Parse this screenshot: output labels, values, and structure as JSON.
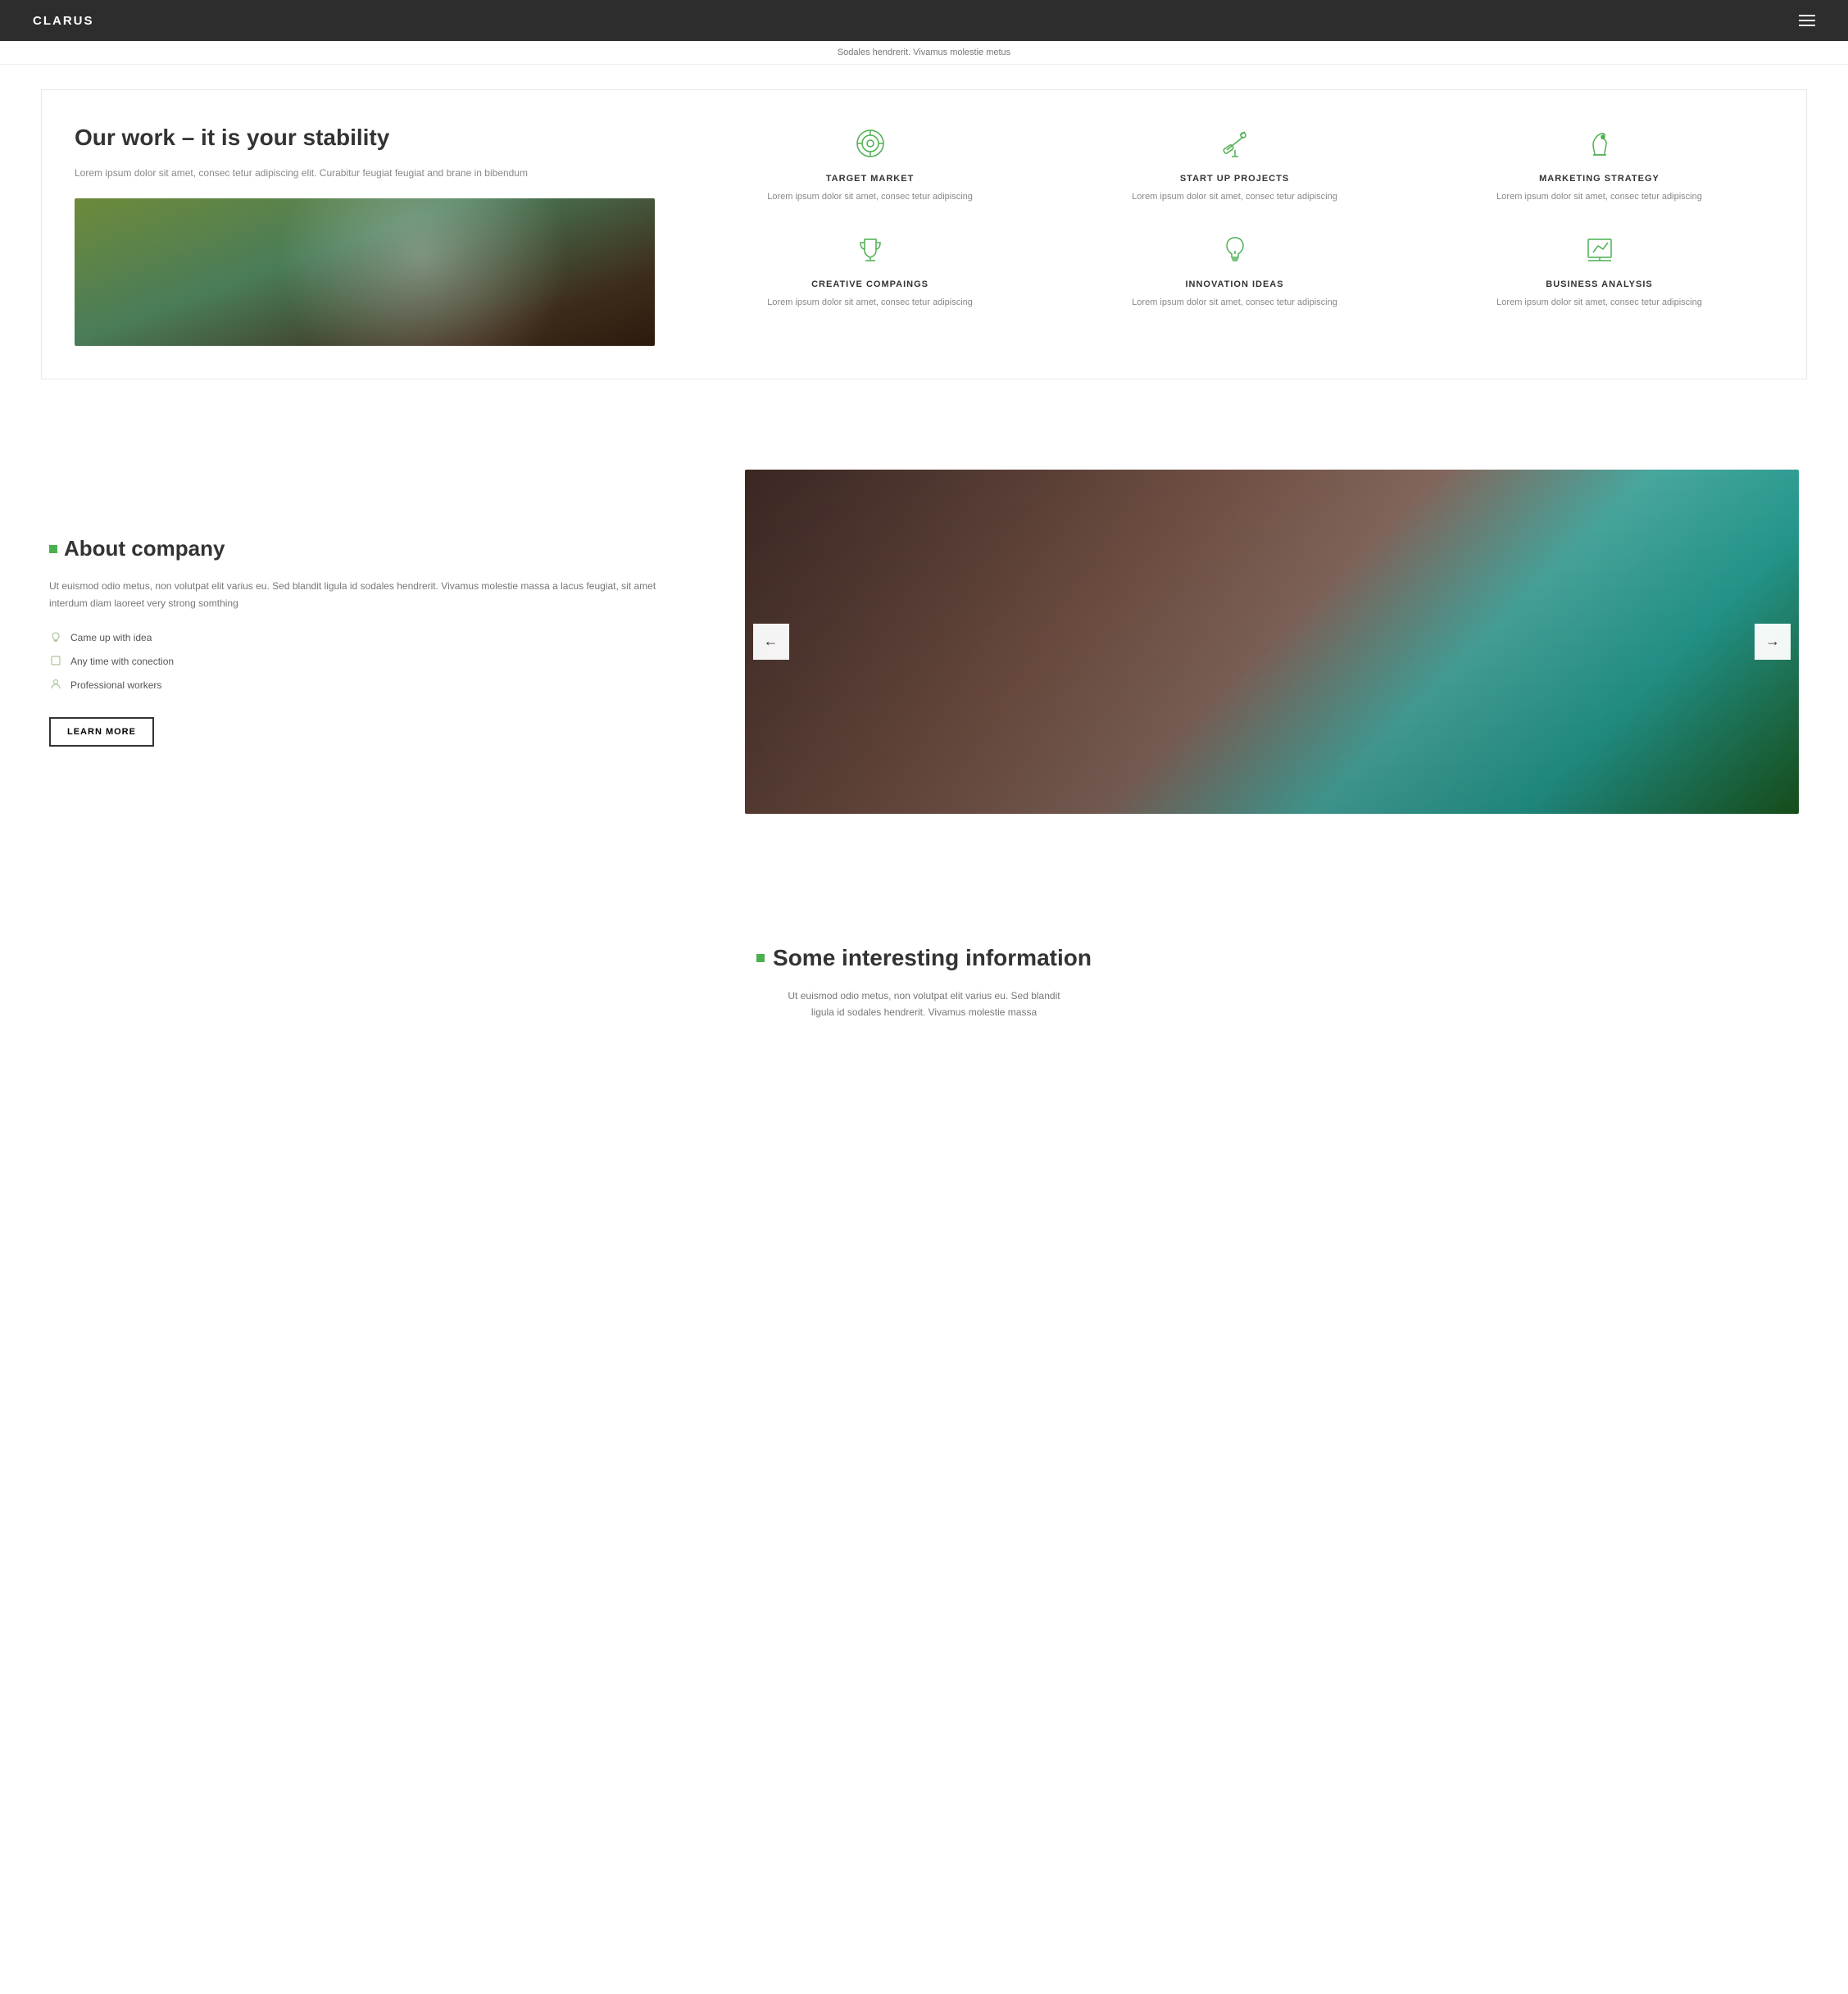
{
  "navbar": {
    "brand": "CLARUS",
    "menu_icon": "hamburger-menu"
  },
  "ticker": {
    "text": "Sodales hendrerit. Vivamus molestie metus"
  },
  "section_work": {
    "title": "Our work – it is your stability",
    "description": "Lorem ipsum dolor sit amet, consec tetur adipiscing elit. Curabitur feugiat feugiat and brane in bibendum",
    "features": [
      {
        "icon": "target-icon",
        "title": "TARGET MARKET",
        "description": "Lorem ipsum dolor sit amet, consec tetur adipiscing"
      },
      {
        "icon": "telescope-icon",
        "title": "START UP PROJECTS",
        "description": "Lorem ipsum dolor sit amet, consec tetur adipiscing"
      },
      {
        "icon": "chess-knight-icon",
        "title": "MARKETING STRATEGY",
        "description": "Lorem ipsum dolor sit amet, consec tetur adipiscing"
      },
      {
        "icon": "trophy-icon",
        "title": "CREATIVE COMPAINGS",
        "description": "Lorem ipsum dolor sit amet, consec tetur adipiscing"
      },
      {
        "icon": "lightbulb-icon",
        "title": "INNOVATION IDEAS",
        "description": "Lorem ipsum dolor sit amet, consec tetur adipiscing"
      },
      {
        "icon": "chart-icon",
        "title": "BUSINESS ANALYSIS",
        "description": "Lorem ipsum dolor sit amet, consec tetur adipiscing"
      }
    ]
  },
  "section_about": {
    "title": "About company",
    "description": "Ut euismod odio metus, non volutpat elit varius eu. Sed blandit ligula id sodales hendrerit. Vivamus molestie massa a lacus feugiat, sit amet interdum diam laoreet very strong somthing",
    "features": [
      {
        "icon": "lightbulb",
        "label": "Came up with idea"
      },
      {
        "icon": "square",
        "label": "Any time with conection"
      },
      {
        "icon": "person",
        "label": "Professional workers"
      }
    ],
    "btn_label": "LEARN MORE",
    "carousel_prev": "←",
    "carousel_next": "→"
  },
  "section_info": {
    "title": "Some interesting information",
    "description": "Ut euismod odio metus, non volutpat elit varius eu. Sed blandit ligula id sodales hendrerit. Vivamus molestie massa"
  },
  "colors": {
    "green": "#4caf50",
    "dark": "#2d2d2d",
    "light_green": "#b0c4a0"
  }
}
